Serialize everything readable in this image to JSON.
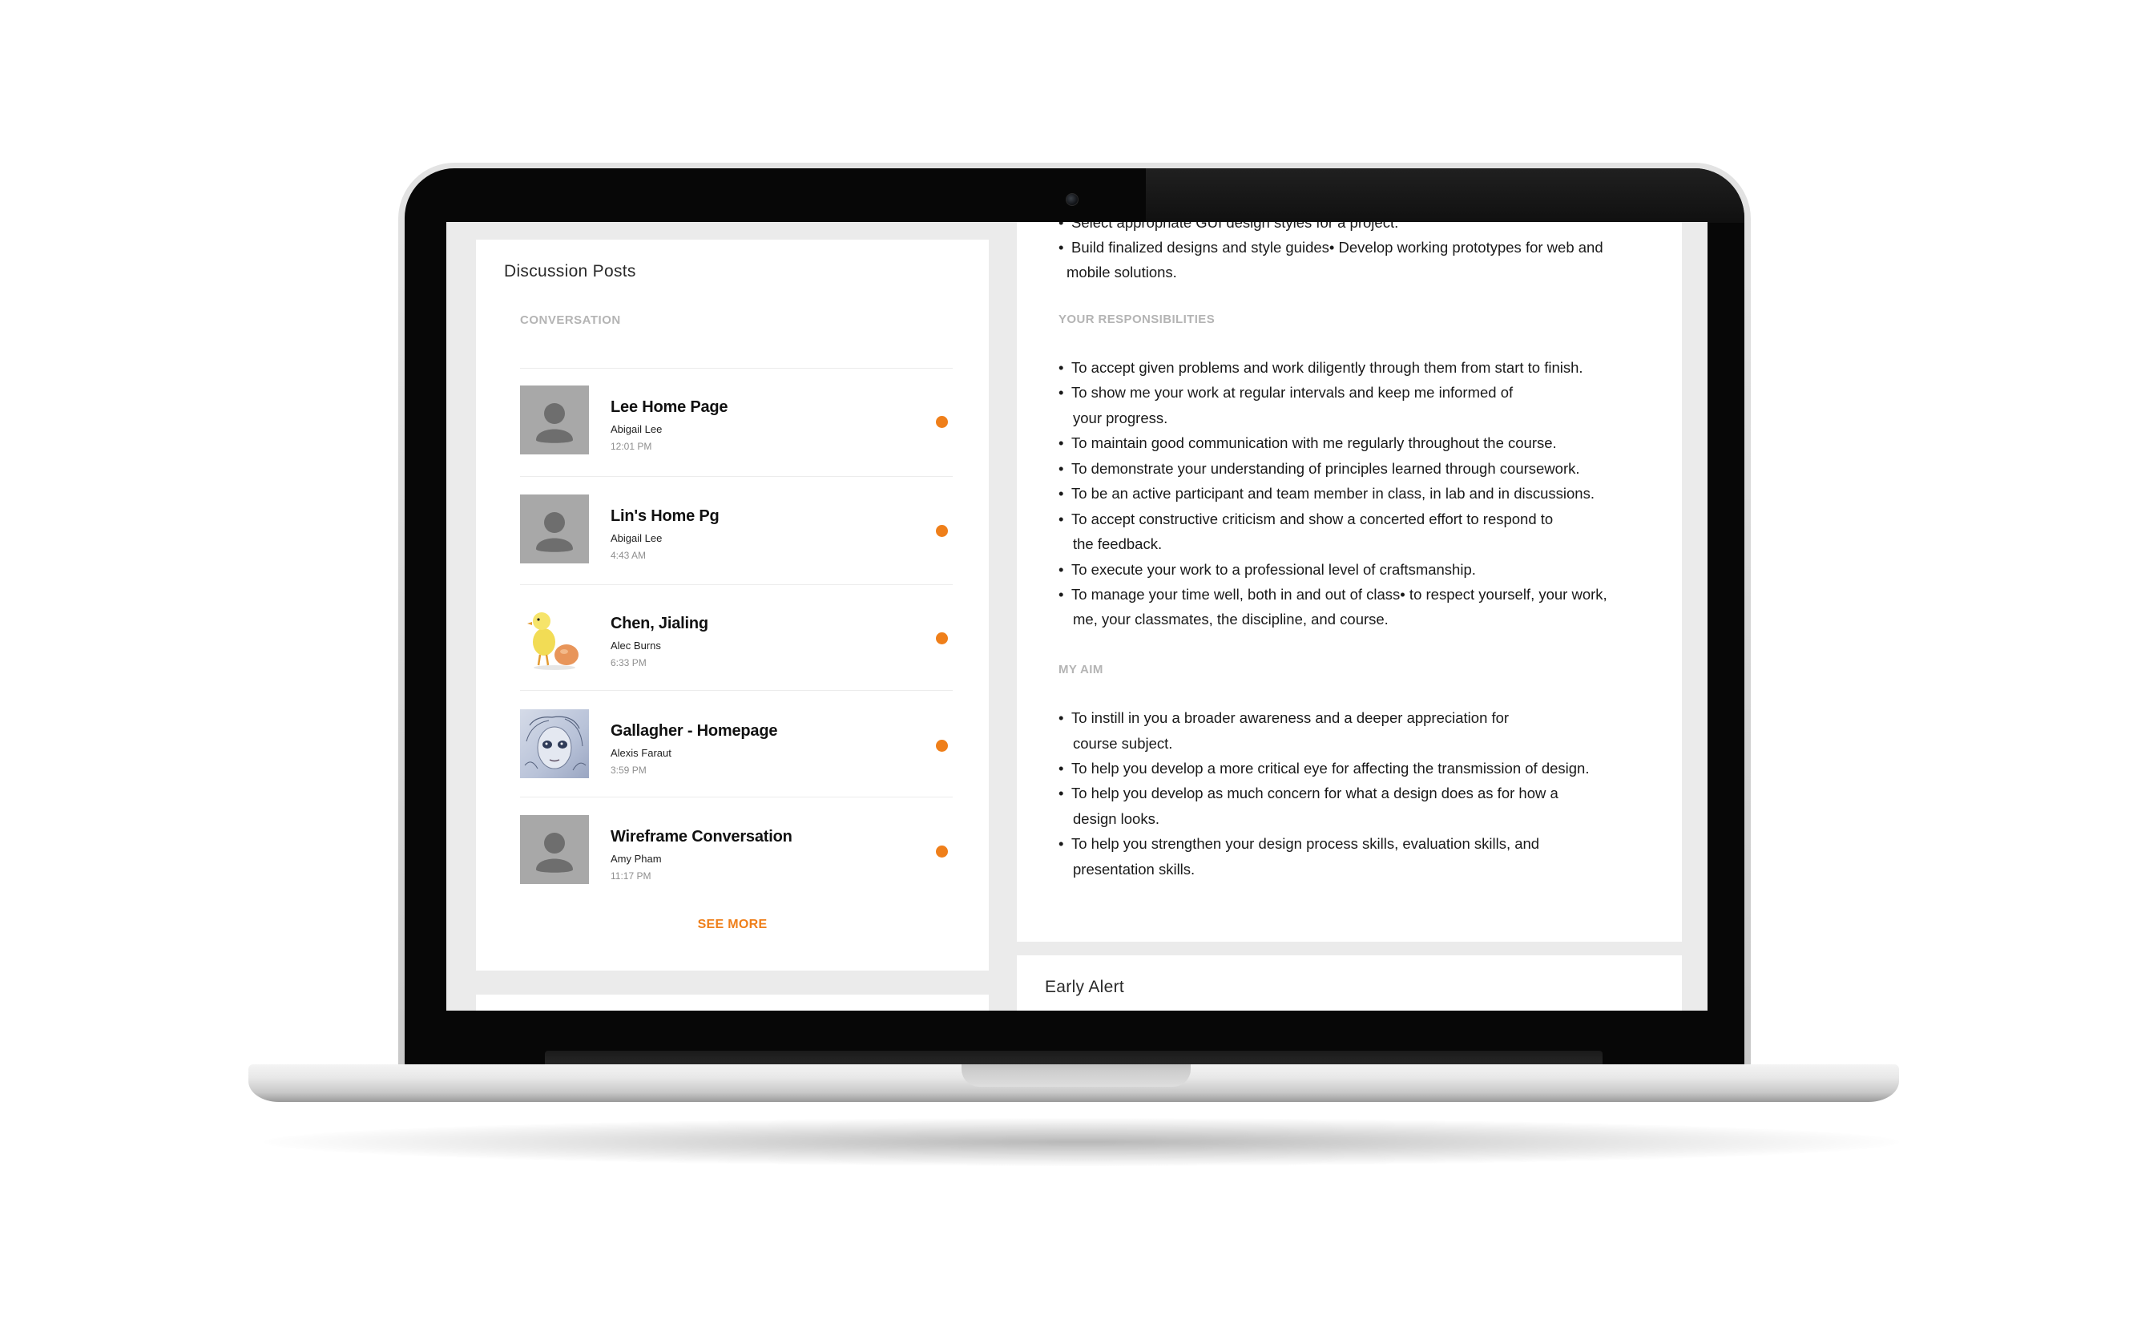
{
  "discussion": {
    "title": "Discussion Posts",
    "section_label": "CONVERSATION",
    "posts": [
      {
        "title": "Lee Home Page",
        "author": "Abigail Lee",
        "time": "12:01 PM",
        "avatar": "generic-user-avatar"
      },
      {
        "title": "Lin's Home Pg",
        "author": "Abigail Lee",
        "time": "4:43 AM",
        "avatar": "generic-user-avatar"
      },
      {
        "title": "Chen, Jialing",
        "author": "Alec Burns",
        "time": "6:33 PM",
        "avatar": "chick-with-egg-avatar"
      },
      {
        "title": "Gallagher - Homepage",
        "author": "Alexis Faraut",
        "time": "3:59 PM",
        "avatar": "sketch-face-avatar"
      },
      {
        "title": "Wireframe Conversation",
        "author": "Amy Pham",
        "time": "11:17 PM",
        "avatar": "generic-user-avatar"
      }
    ],
    "see_more": "SEE MORE",
    "unread_color": "#ef7f1a"
  },
  "syllabus": {
    "top_lines": [
      "Select appropriate GUI design styles for a project.",
      "Build finalized designs and style guides•  Develop working prototypes for web and",
      "mobile solutions."
    ],
    "responsibilities_heading": "YOUR RESPONSIBILITIES",
    "responsibilities": [
      "To accept given problems and work diligently through them from start to finish.",
      "To show me your work at regular intervals and keep me informed of",
      "your progress.",
      "To maintain good communication with me regularly throughout the course.",
      "To demonstrate your understanding of principles learned through coursework.",
      "To be an active participant and team member in class, in lab and in discussions.",
      "To accept constructive criticism and show a concerted effort to respond to",
      "the feedback.",
      "To execute your work to a professional level of craftsmanship.",
      "To manage your time well, both in and out of class•  to respect yourself, your work,",
      "me, your classmates, the discipline, and course."
    ],
    "aim_heading": "MY AIM",
    "aims": [
      "To instill in you a broader awareness and a deeper appreciation for",
      "course subject.",
      "To help you develop a more critical eye for affecting the transmission of design.",
      "To help you develop as much concern for what a design does as for how a",
      "design looks.",
      "To help you strengthen your design process skills, evaluation skills, and",
      "presentation skills."
    ]
  },
  "early_alert": {
    "title": "Early Alert"
  },
  "colors": {
    "accent": "#ef7f1a",
    "screen_bg": "#ebebeb",
    "muted_heading": "#b4b4b4"
  }
}
